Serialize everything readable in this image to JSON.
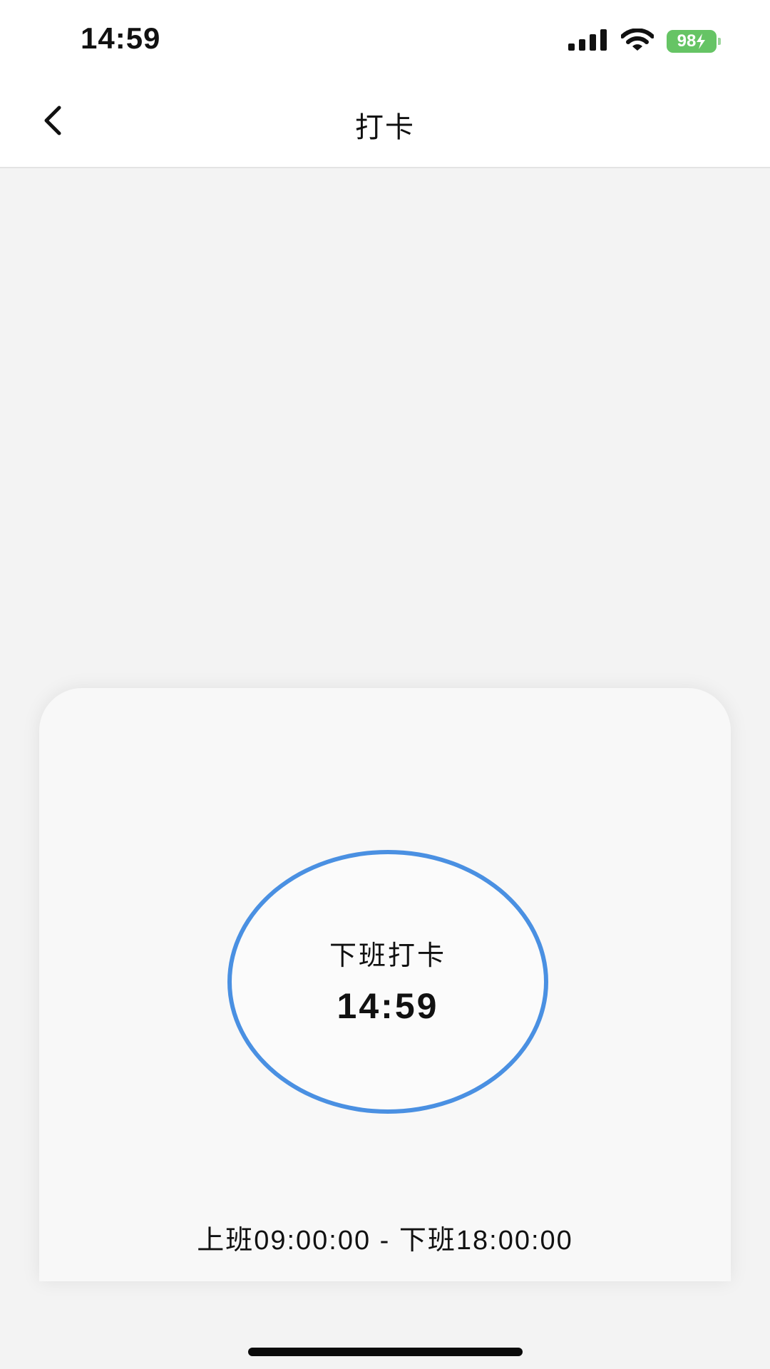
{
  "status_bar": {
    "time": "14:59",
    "battery_level": "98",
    "icons": [
      "signal-icon",
      "wifi-icon",
      "battery-charging-icon"
    ],
    "battery_color": "#66c465"
  },
  "nav": {
    "title": "打卡",
    "back_icon": "chevron-left-icon"
  },
  "punch": {
    "label": "下班打卡",
    "time": "14:59",
    "ring_color": "#4a90e2"
  },
  "schedule": {
    "text": "上班09:00:00 - 下班18:00:00"
  }
}
